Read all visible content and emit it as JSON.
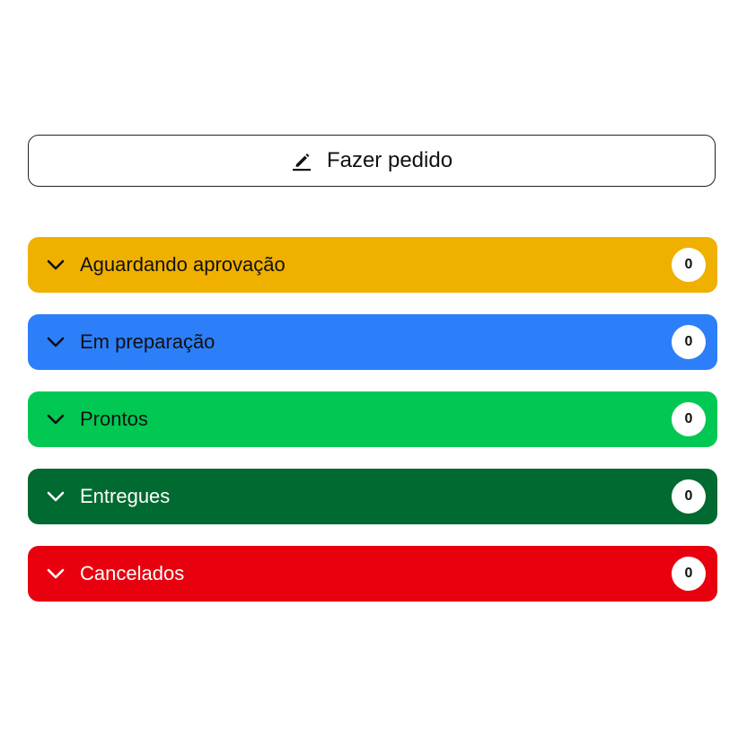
{
  "new_order": {
    "label": "Fazer pedido",
    "icon": "pencil-icon"
  },
  "groups": [
    {
      "id": "aguardando",
      "title": "Aguardando aprovação",
      "count": "0",
      "color": "#F0B000",
      "text_color": "#111111",
      "icon": "chevron-down-icon"
    },
    {
      "id": "preparacao",
      "title": "Em preparação",
      "count": "0",
      "color": "#2D7FF9",
      "text_color": "#111111",
      "icon": "chevron-down-icon"
    },
    {
      "id": "prontos",
      "title": "Prontos",
      "count": "0",
      "color": "#00C853",
      "text_color": "#111111",
      "icon": "chevron-down-icon"
    },
    {
      "id": "entregues",
      "title": "Entregues",
      "count": "0",
      "color": "#006A30",
      "text_color": "#FFFFFF",
      "icon": "chevron-down-icon"
    },
    {
      "id": "cancelados",
      "title": "Cancelados",
      "count": "0",
      "color": "#E8000E",
      "text_color": "#FFFFFF",
      "icon": "chevron-down-icon"
    }
  ]
}
